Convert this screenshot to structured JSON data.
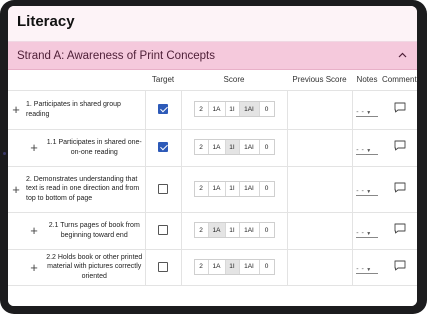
{
  "page": {
    "title": "Literacy"
  },
  "strand": {
    "title": "Strand A: Awareness of Print Concepts",
    "chevron_icon": "chevron-up-icon"
  },
  "columns": {
    "target": "Target",
    "score": "Score",
    "previous_score": "Previous Score",
    "notes": "Notes",
    "comments": "Comments"
  },
  "score_options": [
    "2",
    "1A",
    "1I",
    "1AI",
    "0"
  ],
  "rows": [
    {
      "level": 1,
      "text": "1. Participates in shared group reading",
      "target_checked": true,
      "selected_score": "1AI",
      "previous_score": "",
      "notes_value": "- -"
    },
    {
      "level": 2,
      "text": "1.1 Participates in shared one-on-one reading",
      "target_checked": true,
      "selected_score": "1I",
      "previous_score": "",
      "notes_value": "- -"
    },
    {
      "level": 1,
      "text": "2. Demonstrates understanding that text is read in one direction and from top to bottom of page",
      "target_checked": false,
      "selected_score": "",
      "previous_score": "",
      "notes_value": "- -"
    },
    {
      "level": 2,
      "text": "2.1 Turns pages of book from beginning toward end",
      "target_checked": false,
      "selected_score": "1A",
      "previous_score": "",
      "notes_value": "- -"
    },
    {
      "level": 2,
      "text": "2.2 Holds book or other printed material with pictures correctly oriented",
      "target_checked": false,
      "selected_score": "1I",
      "previous_score": "",
      "notes_value": "- -"
    }
  ],
  "colors": {
    "title_bg": "#fdf3f7",
    "strand_bg": "#f5c9dc",
    "checkbox_checked": "#2d5ab8",
    "score_selected": "#e4e4e4"
  }
}
